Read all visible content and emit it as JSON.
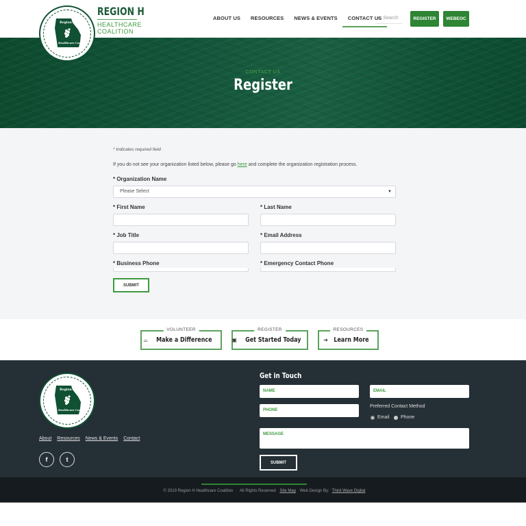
{
  "header": {
    "logo": {
      "line1": "REGION H",
      "line2": "HEALTHCARE",
      "line3": "COALITION",
      "seal_top_text": "Region H",
      "seal_bottom_text": "Healthcare Coalition"
    },
    "nav": [
      {
        "label": "ABOUT US",
        "active": false
      },
      {
        "label": "RESOURCES",
        "active": false
      },
      {
        "label": "NEWS & EVENTS",
        "active": false
      },
      {
        "label": "CONTACT US",
        "active": true
      }
    ],
    "search": {
      "icon": "search-icon",
      "placeholder": "Search"
    },
    "buttons": {
      "register": "REGISTER",
      "webeoc": "WEBEOC"
    }
  },
  "hero": {
    "overline": "CONTACT US",
    "title": "Register"
  },
  "form": {
    "required_note": "* Indicates required field",
    "info_before": "If you do not see your organization listed below, please go ",
    "info_link": "here",
    "info_after": " and complete the organization registration process.",
    "organization": {
      "label": "* Organization Name",
      "selected": "Please Select"
    },
    "first_name": {
      "label": "* First Name",
      "value": ""
    },
    "last_name": {
      "label": "* Last Name",
      "value": ""
    },
    "job_title": {
      "label": "* Job Title",
      "value": ""
    },
    "email": {
      "label": "* Email Address",
      "value": ""
    },
    "business_phone": {
      "label": "* Business Phone",
      "value": ""
    },
    "emergency_phone": {
      "label": "* Emergency Contact Phone",
      "value": ""
    },
    "submit": "SUBMIT"
  },
  "cta": [
    {
      "tag": "VOLUNTEER",
      "label": "Make a Difference",
      "icon": "handshake-icon",
      "glyph": "🤝"
    },
    {
      "tag": "REGISTER",
      "label": "Get Started Today",
      "icon": "clipboard-icon",
      "glyph": "▣"
    },
    {
      "tag": "RESOURCES",
      "label": "Learn More",
      "icon": "sign-in-icon",
      "glyph": "➜"
    }
  ],
  "footer": {
    "links": [
      "About",
      "Resources",
      "News & Events",
      "Contact"
    ],
    "social": [
      {
        "name": "facebook",
        "glyph": "f"
      },
      {
        "name": "twitter",
        "glyph": "t"
      }
    ],
    "get_in_touch": {
      "title": "Get in Touch",
      "name_placeholder": "NAME",
      "email_placeholder": "EMAIL",
      "phone_placeholder": "PHONE",
      "message_placeholder": "MESSAGE",
      "preferred_label": "Preferred Contact Method",
      "options": [
        {
          "label": "Email",
          "checked": true
        },
        {
          "label": "Phone",
          "checked": false
        }
      ],
      "submit": "SUBMIT"
    }
  },
  "bottom": {
    "copyright": "© 2019 Region H Healthcare Coalition",
    "rights": "All Rights Reserved",
    "sitemap": "Site Map",
    "design_label": "Web Design By:",
    "design_link": "Third Wave Digital"
  },
  "colors": {
    "brand_green": "#2e8534",
    "dark_green": "#0f5132",
    "accent_green": "#3c9a3e",
    "footer_bg": "#252f36",
    "bottom_bg": "#161b1f"
  }
}
